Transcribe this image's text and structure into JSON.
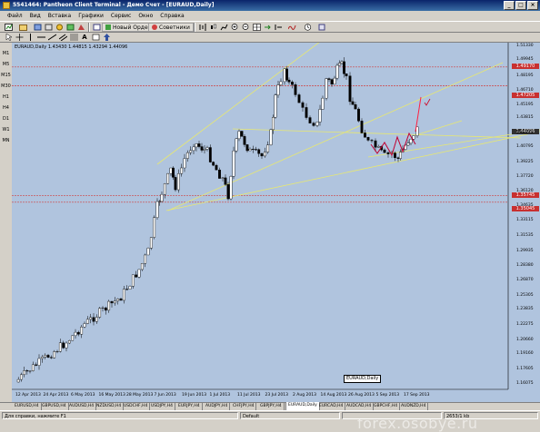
{
  "window": {
    "title": "5541464: Pantheon Client Terminal - Демо Счет - [EURAUD,Daily]",
    "buttons": [
      "_",
      "□",
      "×"
    ]
  },
  "menu": [
    "Файл",
    "Вид",
    "Вставка",
    "Графики",
    "Сервис",
    "Окно",
    "Справка"
  ],
  "toolbar": {
    "new_order_label": "Новый Ордер",
    "advisors_label": "Советники"
  },
  "timeframes": [
    "M1",
    "M5",
    "M15",
    "M30",
    "H1",
    "H4",
    "D1",
    "W1",
    "MN"
  ],
  "chart": {
    "title": "EURAUD,Daily  1.43430 1.44815 1.43294 1.44096",
    "tooltip": "EURAUD,Daily"
  },
  "price_tags": {
    "p1": "1.49170",
    "p2": "1.47205",
    "p3": "1.44096",
    "p4": "1.35745",
    "p5": "1.35045"
  },
  "chart_data": {
    "type": "candlestick",
    "symbol": "EURAUD",
    "timeframe": "Daily",
    "y_axis_labels": [
      "1.51330",
      "1.49945",
      "1.48195",
      "1.46710",
      "1.45195",
      "1.43815",
      "1.42275",
      "1.40795",
      "1.39225",
      "1.37720",
      "1.36120",
      "1.34635",
      "1.33115",
      "1.31535",
      "1.29935",
      "1.28380",
      "1.26870",
      "1.25305",
      "1.23835",
      "1.22275",
      "1.20660",
      "1.19160",
      "1.17605",
      "1.16075"
    ],
    "x_axis_labels": [
      "12 Apr 2013",
      "24 Apr 2013",
      "6 May 2013",
      "16 May 2013",
      "28 May 2013",
      "7 Jun 2013",
      "19 Jun 2013",
      "1 Jul 2013",
      "11 Jul 2013",
      "23 Jul 2013",
      "2 Aug 2013",
      "14 Aug 2013",
      "26 Aug 2013",
      "5 Sep 2013",
      "17 Sep 2013"
    ],
    "ylim": [
      1.16075,
      1.5133
    ],
    "horizontal_levels": [
      1.4917,
      1.47205,
      1.35745,
      1.35045
    ],
    "background": "#b0c4de",
    "bull_color": "#ffffff",
    "bear_color": "#000000",
    "trendline_color": "#e8e870",
    "level_color": "#d04040"
  },
  "tabs": [
    "EURUSD,H4",
    "GBPUSD,H4",
    "AUDUSD,H4",
    "NZDUSD,H4",
    "USDCHF,H4",
    "USDJPY,H4",
    "EURJPY,H4",
    "AUDJPY,H4",
    "CHFJPY,H4",
    "GBPJPY,H4",
    "EURAUD,Daily",
    "EURCAD,H4",
    "AUDCAD,H4",
    "GBPCHF,H4",
    "AUDNZD,H4"
  ],
  "status": {
    "help": "Для справки, нажмите F1",
    "profile": "Default",
    "traffic": "2653/1 kb"
  },
  "watermark": "forex.osobye.ru"
}
